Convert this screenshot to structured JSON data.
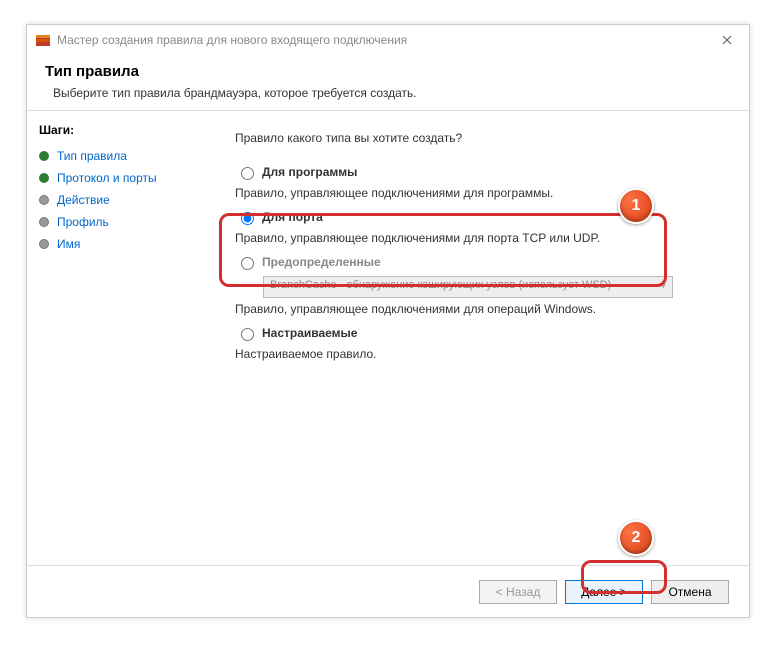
{
  "window": {
    "title": "Мастер создания правила для нового входящего подключения"
  },
  "header": {
    "title": "Тип правила",
    "subtitle": "Выберите тип правила брандмауэра, которое требуется создать."
  },
  "steps": {
    "label": "Шаги:",
    "items": [
      {
        "label": "Тип правила"
      },
      {
        "label": "Протокол и порты"
      },
      {
        "label": "Действие"
      },
      {
        "label": "Профиль"
      },
      {
        "label": "Имя"
      }
    ]
  },
  "content": {
    "prompt": "Правило какого типа вы хотите создать?",
    "options": {
      "program": {
        "label": "Для программы",
        "desc": "Правило, управляющее подключениями для программы."
      },
      "port": {
        "label": "Для порта",
        "desc": "Правило, управляющее подключениями для порта TCP или UDP."
      },
      "predefined": {
        "label": "Предопределенные",
        "dropdown": "BranchCache - обнаружение кэширующих узлов (использует WSD)",
        "desc": "Правило, управляющее подключениями для операций Windows."
      },
      "custom": {
        "label": "Настраиваемые",
        "desc": "Настраиваемое правило."
      }
    }
  },
  "footer": {
    "back": "< Назад",
    "next": "Далее >",
    "cancel": "Отмена"
  },
  "annotations": {
    "badge1": "1",
    "badge2": "2"
  }
}
